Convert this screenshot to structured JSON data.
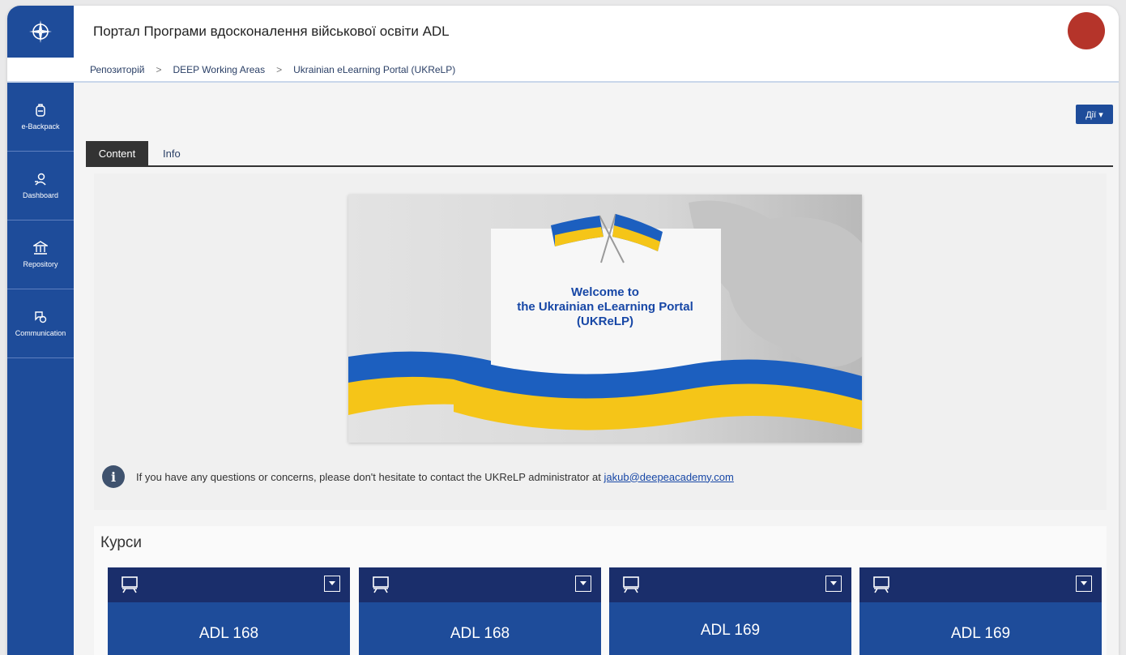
{
  "header": {
    "title": "Портал Програми вдосконалення військової освіти ADL",
    "avatar_color": "#b5342a"
  },
  "breadcrumb": {
    "items": [
      "Репозиторій",
      "DEEP Working Areas",
      "Ukrainian eLearning Portal (UKReLP)"
    ],
    "separator": ">"
  },
  "sidebar": {
    "items": [
      {
        "label": "e-Backpack",
        "icon": "backpack-icon"
      },
      {
        "label": "Dashboard",
        "icon": "dashboard-icon"
      },
      {
        "label": "Repository",
        "icon": "repository-icon"
      },
      {
        "label": "Communication",
        "icon": "communication-icon"
      }
    ]
  },
  "toolbar": {
    "actions_label": "Дії ▾"
  },
  "tabs": [
    {
      "label": "Content",
      "active": true
    },
    {
      "label": "Info",
      "active": false
    }
  ],
  "banner": {
    "lines": [
      "Welcome to",
      "the Ukrainian eLearning Portal",
      "(UKReLP)"
    ]
  },
  "info": {
    "text": "If you have any questions or concerns, please don't hesitate to contact the UKReLP administrator at",
    "email": "jakub@deepeacademy.com"
  },
  "courses": {
    "title": "Курси",
    "items": [
      {
        "name": "ADL 168"
      },
      {
        "name": "ADL 168"
      },
      {
        "name": "ADL 169"
      },
      {
        "name": "ADL 169"
      }
    ]
  },
  "colors": {
    "brand_blue": "#1e4c9a",
    "card_header": "#1a2e6b",
    "flag_blue": "#1c5fbf",
    "flag_yellow": "#f5c518"
  }
}
